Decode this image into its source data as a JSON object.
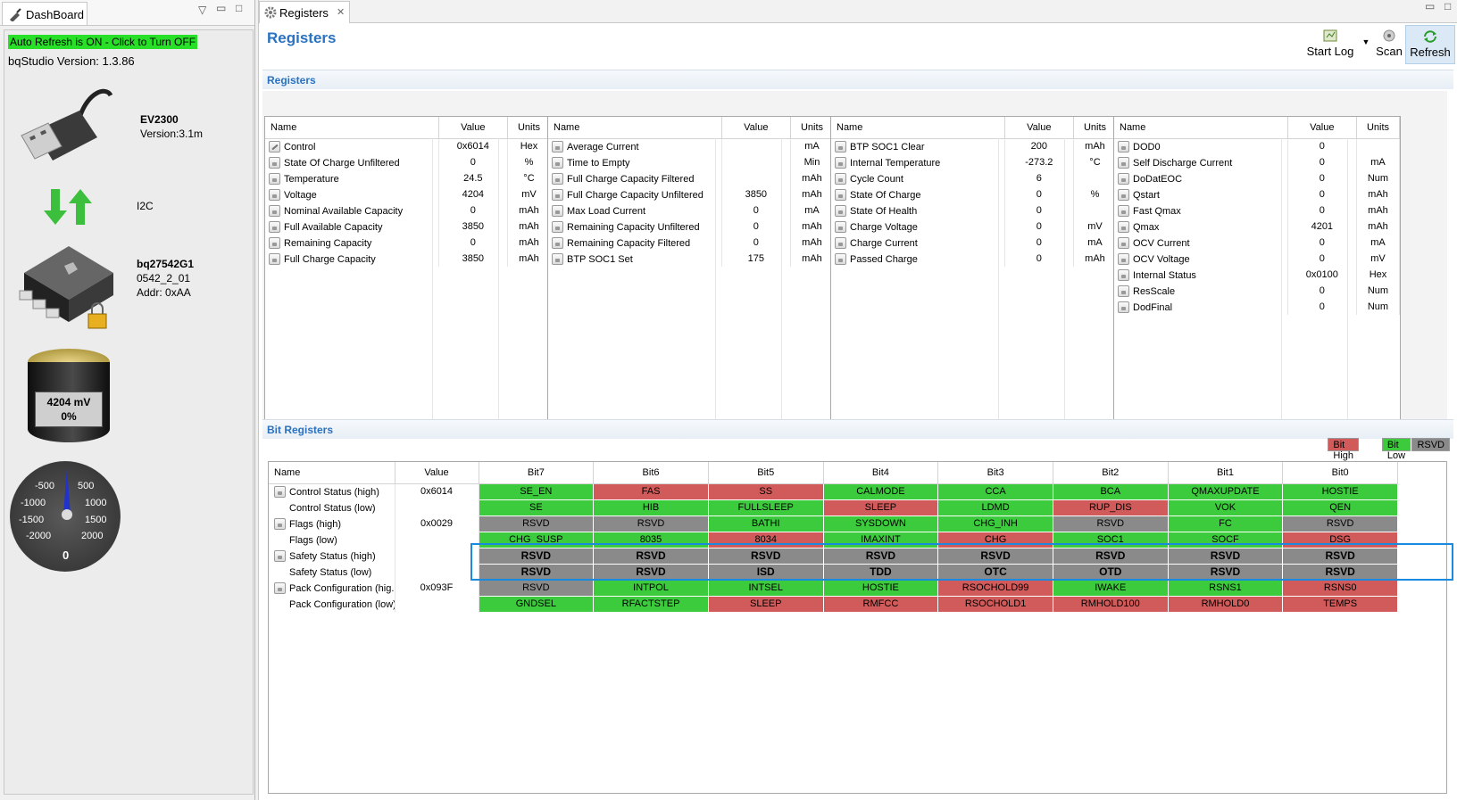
{
  "dashboard": {
    "tab_label": "DashBoard",
    "auto_refresh": "Auto Refresh is ON - Click to Turn OFF",
    "bq_version": "bqStudio Version:  1.3.86",
    "adapter": {
      "name": "EV2300",
      "version": "Version:3.1m"
    },
    "protocol": "I2C",
    "device": {
      "name": "bq27542G1",
      "fw": "0542_2_01",
      "addr": "Addr: 0xAA"
    },
    "battery": {
      "voltage": "4204 mV",
      "soc": "0%"
    },
    "gauge": {
      "ticks": [
        "-500",
        "500",
        "-1000",
        "1000",
        "-1500",
        "1500",
        "-2000",
        "2000"
      ],
      "value": "0"
    }
  },
  "registers": {
    "tab_label": "Registers",
    "title": "Registers",
    "toolbar": {
      "start_log": "Start Log",
      "scan": "Scan",
      "refresh": "Refresh"
    },
    "section_label": "Registers",
    "columns": [
      "Name",
      "Value",
      "Units"
    ],
    "tables": [
      [
        {
          "name": "Control",
          "value": "0x6014",
          "units": "Hex",
          "icon": "pencil"
        },
        {
          "name": "State Of Charge Unfiltered",
          "value": "0",
          "units": "%"
        },
        {
          "name": "Temperature",
          "value": "24.5",
          "units": "°C"
        },
        {
          "name": "Voltage",
          "value": "4204",
          "units": "mV"
        },
        {
          "name": "Nominal Available Capacity",
          "value": "0",
          "units": "mAh"
        },
        {
          "name": "Full Available Capacity",
          "value": "3850",
          "units": "mAh"
        },
        {
          "name": "Remaining Capacity",
          "value": "0",
          "units": "mAh"
        },
        {
          "name": "Full Charge Capacity",
          "value": "3850",
          "units": "mAh"
        }
      ],
      [
        {
          "name": "Average Current",
          "value": "",
          "units": "mA"
        },
        {
          "name": "Time to Empty",
          "value": "",
          "units": "Min"
        },
        {
          "name": "Full Charge Capacity Filtered",
          "value": "",
          "units": "mAh"
        },
        {
          "name": "Full Charge Capacity Unfiltered",
          "value": "3850",
          "units": "mAh"
        },
        {
          "name": "Max Load Current",
          "value": "0",
          "units": "mA"
        },
        {
          "name": "Remaining Capacity Unfiltered",
          "value": "0",
          "units": "mAh"
        },
        {
          "name": "Remaining Capacity Filtered",
          "value": "0",
          "units": "mAh"
        },
        {
          "name": "BTP SOC1 Set",
          "value": "175",
          "units": "mAh"
        }
      ],
      [
        {
          "name": "BTP SOC1 Clear",
          "value": "200",
          "units": "mAh"
        },
        {
          "name": "Internal Temperature",
          "value": "-273.2",
          "units": "°C"
        },
        {
          "name": "Cycle Count",
          "value": "6",
          "units": ""
        },
        {
          "name": "State Of Charge",
          "value": "0",
          "units": "%"
        },
        {
          "name": "State Of Health",
          "value": "0",
          "units": ""
        },
        {
          "name": "Charge Voltage",
          "value": "0",
          "units": "mV"
        },
        {
          "name": "Charge Current",
          "value": "0",
          "units": "mA"
        },
        {
          "name": "Passed Charge",
          "value": "0",
          "units": "mAh"
        }
      ],
      [
        {
          "name": "DOD0",
          "value": "0",
          "units": ""
        },
        {
          "name": "Self Discharge Current",
          "value": "0",
          "units": "mA"
        },
        {
          "name": "DoDatEOC",
          "value": "0",
          "units": "Num"
        },
        {
          "name": "Qstart",
          "value": "0",
          "units": "mAh"
        },
        {
          "name": "Fast Qmax",
          "value": "0",
          "units": "mAh"
        },
        {
          "name": "Qmax",
          "value": "4201",
          "units": "mAh"
        },
        {
          "name": "OCV Current",
          "value": "0",
          "units": "mA"
        },
        {
          "name": "OCV Voltage",
          "value": "0",
          "units": "mV"
        },
        {
          "name": "Internal Status",
          "value": "0x0100",
          "units": "Hex"
        },
        {
          "name": "ResScale",
          "value": "0",
          "units": "Num"
        },
        {
          "name": "DodFinal",
          "value": "0",
          "units": "Num"
        }
      ]
    ]
  },
  "bit_registers": {
    "section_label": "Bit Registers",
    "legend": {
      "high": "Bit High",
      "low": "Bit Low",
      "rsvd": "RSVD"
    },
    "colors": {
      "high": "#d15a5a",
      "low": "#3ccb3c",
      "rsvd": "#8a8a8a",
      "selection": "#1a8ae0"
    },
    "columns": [
      "Name",
      "Value",
      "Bit7",
      "Bit6",
      "Bit5",
      "Bit4",
      "Bit3",
      "Bit2",
      "Bit1",
      "Bit0"
    ],
    "rows": [
      {
        "name": "Control Status (high)",
        "value": "0x6014",
        "lock": true,
        "bits": [
          [
            "SE_EN",
            "low"
          ],
          [
            "FAS",
            "high"
          ],
          [
            "SS",
            "high"
          ],
          [
            "CALMODE",
            "low"
          ],
          [
            "CCA",
            "low"
          ],
          [
            "BCA",
            "low"
          ],
          [
            "QMAXUPDATE",
            "low"
          ],
          [
            "HOSTIE",
            "low"
          ]
        ]
      },
      {
        "name": "Control Status (low)",
        "value": "",
        "lock": false,
        "bits": [
          [
            "SE",
            "low"
          ],
          [
            "HIB",
            "low"
          ],
          [
            "FULLSLEEP",
            "low"
          ],
          [
            "SLEEP",
            "high"
          ],
          [
            "LDMD",
            "low"
          ],
          [
            "RUP_DIS",
            "high"
          ],
          [
            "VOK",
            "low"
          ],
          [
            "QEN",
            "low"
          ]
        ]
      },
      {
        "name": "Flags (high)",
        "value": "0x0029",
        "lock": true,
        "bits": [
          [
            "RSVD",
            "rsvd"
          ],
          [
            "RSVD",
            "rsvd"
          ],
          [
            "BATHI",
            "low"
          ],
          [
            "SYSDOWN",
            "low"
          ],
          [
            "CHG_INH",
            "low"
          ],
          [
            "RSVD",
            "rsvd"
          ],
          [
            "FC",
            "low"
          ],
          [
            "RSVD",
            "rsvd"
          ]
        ]
      },
      {
        "name": "Flags (low)",
        "value": "",
        "lock": false,
        "bits": [
          [
            "CHG_SUSP",
            "low"
          ],
          [
            "8035",
            "low"
          ],
          [
            "8034",
            "high"
          ],
          [
            "IMAXINT",
            "low"
          ],
          [
            "CHG",
            "high"
          ],
          [
            "SOC1",
            "low"
          ],
          [
            "SOCF",
            "low"
          ],
          [
            "DSG",
            "high"
          ]
        ]
      },
      {
        "name": "Safety Status (high)",
        "value": "",
        "lock": true,
        "bold": true,
        "bits": [
          [
            "RSVD",
            "rsvd"
          ],
          [
            "RSVD",
            "rsvd"
          ],
          [
            "RSVD",
            "rsvd"
          ],
          [
            "RSVD",
            "rsvd"
          ],
          [
            "RSVD",
            "rsvd"
          ],
          [
            "RSVD",
            "rsvd"
          ],
          [
            "RSVD",
            "rsvd"
          ],
          [
            "RSVD",
            "rsvd"
          ]
        ]
      },
      {
        "name": "Safety Status (low)",
        "value": "",
        "lock": false,
        "bold": true,
        "bits": [
          [
            "RSVD",
            "rsvd"
          ],
          [
            "RSVD",
            "rsvd"
          ],
          [
            "ISD",
            "rsvd"
          ],
          [
            "TDD",
            "rsvd"
          ],
          [
            "OTC",
            "rsvd"
          ],
          [
            "OTD",
            "rsvd"
          ],
          [
            "RSVD",
            "rsvd"
          ],
          [
            "RSVD",
            "rsvd"
          ]
        ]
      },
      {
        "name": "Pack Configuration (hig...",
        "value": "0x093F",
        "lock": true,
        "bits": [
          [
            "RSVD",
            "rsvd"
          ],
          [
            "INTPOL",
            "low"
          ],
          [
            "INTSEL",
            "low"
          ],
          [
            "HOSTIE",
            "low"
          ],
          [
            "RSOCHOLD99",
            "high"
          ],
          [
            "IWAKE",
            "low"
          ],
          [
            "RSNS1",
            "low"
          ],
          [
            "RSNS0",
            "high"
          ]
        ]
      },
      {
        "name": "Pack Configuration (low)",
        "value": "",
        "lock": false,
        "bits": [
          [
            "GNDSEL",
            "low"
          ],
          [
            "RFACTSTEP",
            "low"
          ],
          [
            "SLEEP",
            "high"
          ],
          [
            "RMFCC",
            "high"
          ],
          [
            "RSOCHOLD1",
            "high"
          ],
          [
            "RMHOLD100",
            "high"
          ],
          [
            "RMHOLD0",
            "high"
          ],
          [
            "TEMPS",
            "high"
          ]
        ]
      }
    ]
  }
}
